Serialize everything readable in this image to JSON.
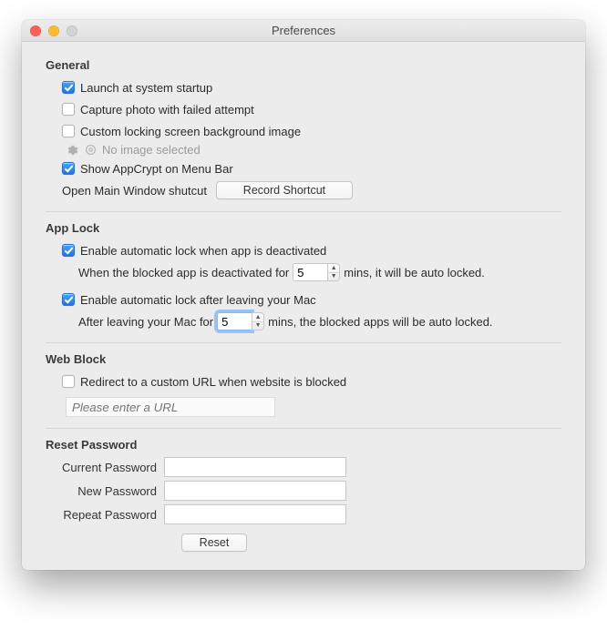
{
  "window": {
    "title": "Preferences"
  },
  "general": {
    "heading": "General",
    "launch_label": "Launch at system startup",
    "launch_checked": true,
    "capture_label": "Capture photo with failed attempt",
    "capture_checked": false,
    "custom_bg_label": "Custom locking screen background image",
    "custom_bg_checked": false,
    "no_image_text": "No image selected",
    "menubar_label": "Show AppCrypt on Menu Bar",
    "menubar_checked": true,
    "shortcut_label": "Open Main Window shutcut",
    "record_btn": "Record Shortcut"
  },
  "applock": {
    "heading": "App Lock",
    "deact_label": "Enable automatic lock when app is deactivated",
    "deact_checked": true,
    "deact_pre": "When the blocked app is deactivated for",
    "deact_value": "5",
    "deact_post": "mins, it will be auto locked.",
    "leave_label": "Enable automatic lock after leaving your Mac",
    "leave_checked": true,
    "leave_pre": "After leaving your Mac for",
    "leave_value": "5",
    "leave_post": "mins, the blocked apps will be auto locked."
  },
  "webblock": {
    "heading": "Web Block",
    "redirect_label": "Redirect to a custom URL when website is blocked",
    "redirect_checked": false,
    "url_placeholder": "Please enter a URL"
  },
  "reset": {
    "heading": "Reset Password",
    "current_label": "Current Password",
    "new_label": "New Password",
    "repeat_label": "Repeat Password",
    "reset_btn": "Reset"
  }
}
